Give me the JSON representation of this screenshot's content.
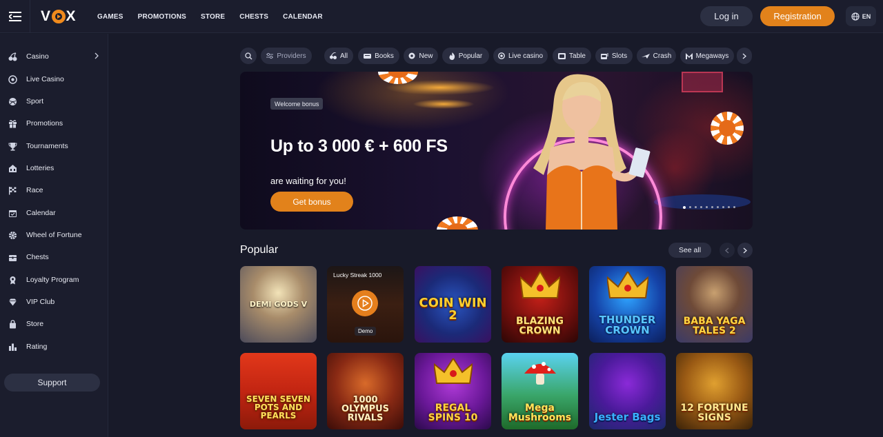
{
  "header": {
    "logo": "VOX",
    "nav": [
      "GAMES",
      "PROMOTIONS",
      "STORE",
      "CHESTS",
      "CALENDAR"
    ],
    "login_label": "Log in",
    "register_label": "Registration",
    "language": "EN"
  },
  "sidebar": {
    "items": [
      {
        "label": "Casino",
        "icon": "cherries-icon",
        "has_arrow": true
      },
      {
        "label": "Live Casino",
        "icon": "live-chip-icon"
      },
      {
        "label": "Sport",
        "icon": "ball-icon"
      },
      {
        "label": "Promotions",
        "icon": "gift-icon"
      },
      {
        "label": "Tournaments",
        "icon": "trophy-icon"
      },
      {
        "label": "Lotteries",
        "icon": "lottery-icon"
      },
      {
        "label": "Race",
        "icon": "flag-icon"
      },
      {
        "label": "Calendar",
        "icon": "calendar-icon"
      },
      {
        "label": "Wheel of Fortune",
        "icon": "wheel-icon"
      },
      {
        "label": "Chests",
        "icon": "chest-icon"
      },
      {
        "label": "Loyalty Program",
        "icon": "medal-icon"
      },
      {
        "label": "VIP Club",
        "icon": "diamond-icon"
      },
      {
        "label": "Store",
        "icon": "bag-icon"
      },
      {
        "label": "Rating",
        "icon": "bars-icon"
      }
    ],
    "support_label": "Support"
  },
  "filters": {
    "providers_label": "Providers",
    "categories": [
      "All",
      "Books",
      "New",
      "Popular",
      "Live casino",
      "Table",
      "Slots",
      "Crash",
      "Megaways"
    ]
  },
  "banner": {
    "tag": "Welcome bonus",
    "headline": "Up to 3 000 € + 600 FS",
    "subline": "are waiting for you!",
    "cta": "Get bonus"
  },
  "popular": {
    "title": "Popular",
    "see_all": "See all",
    "games": [
      {
        "name": "DEMI GODS V"
      },
      {
        "name": "Lucky Streak 1000",
        "demo": "Demo"
      },
      {
        "name": "COIN WIN 2"
      },
      {
        "name": "BLAZING CROWN"
      },
      {
        "name": "THUNDER CROWN"
      },
      {
        "name": "BABA YAGA TALES 2"
      },
      {
        "name": "SEVEN SEVEN POTS AND PEARLS"
      },
      {
        "name": "1000 OLYMPUS RIVALS"
      },
      {
        "name": "REGAL SPINS 10"
      },
      {
        "name": "Mega Mushrooms"
      },
      {
        "name": "Jester Bags"
      },
      {
        "name": "12 FORTUNE SIGNS"
      }
    ]
  },
  "colors": {
    "background": "#181a29",
    "panel": "#1b1d2d",
    "accent": "#e2821b",
    "chip": "#2a2d40"
  }
}
